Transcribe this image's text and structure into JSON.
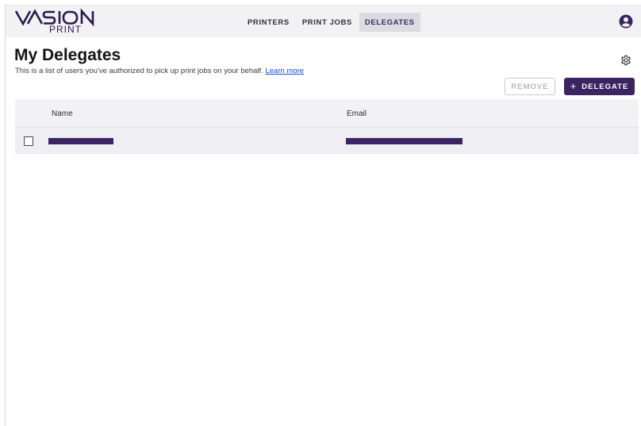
{
  "app": {
    "logo_text": "VASION",
    "logo_sub": "PRINT"
  },
  "nav": {
    "items": [
      {
        "label": "PRINTERS"
      },
      {
        "label": "PRINT JOBS"
      },
      {
        "label": "DELEGATES"
      }
    ],
    "active": "DELEGATES"
  },
  "page": {
    "title": "My Delegates",
    "subtitle": "This is a list of users you've authorized to pick up print jobs on your behalf.",
    "learn_more": "Learn more"
  },
  "toolbar": {
    "remove_label": "REMOVE",
    "add_label": "DELEGATE",
    "add_icon": "+"
  },
  "table": {
    "columns": [
      "Name",
      "Email"
    ],
    "rows": [
      {
        "name": "[redacted]",
        "email": "[redacted]"
      }
    ]
  },
  "icons": {
    "account": "account-circle-icon",
    "settings": "gear-icon"
  },
  "colors": {
    "brand": "#3c2463",
    "topbar_bg": "#f2f2f4",
    "active_tab_bg": "#dcdae3",
    "link": "#1a4bdc"
  }
}
